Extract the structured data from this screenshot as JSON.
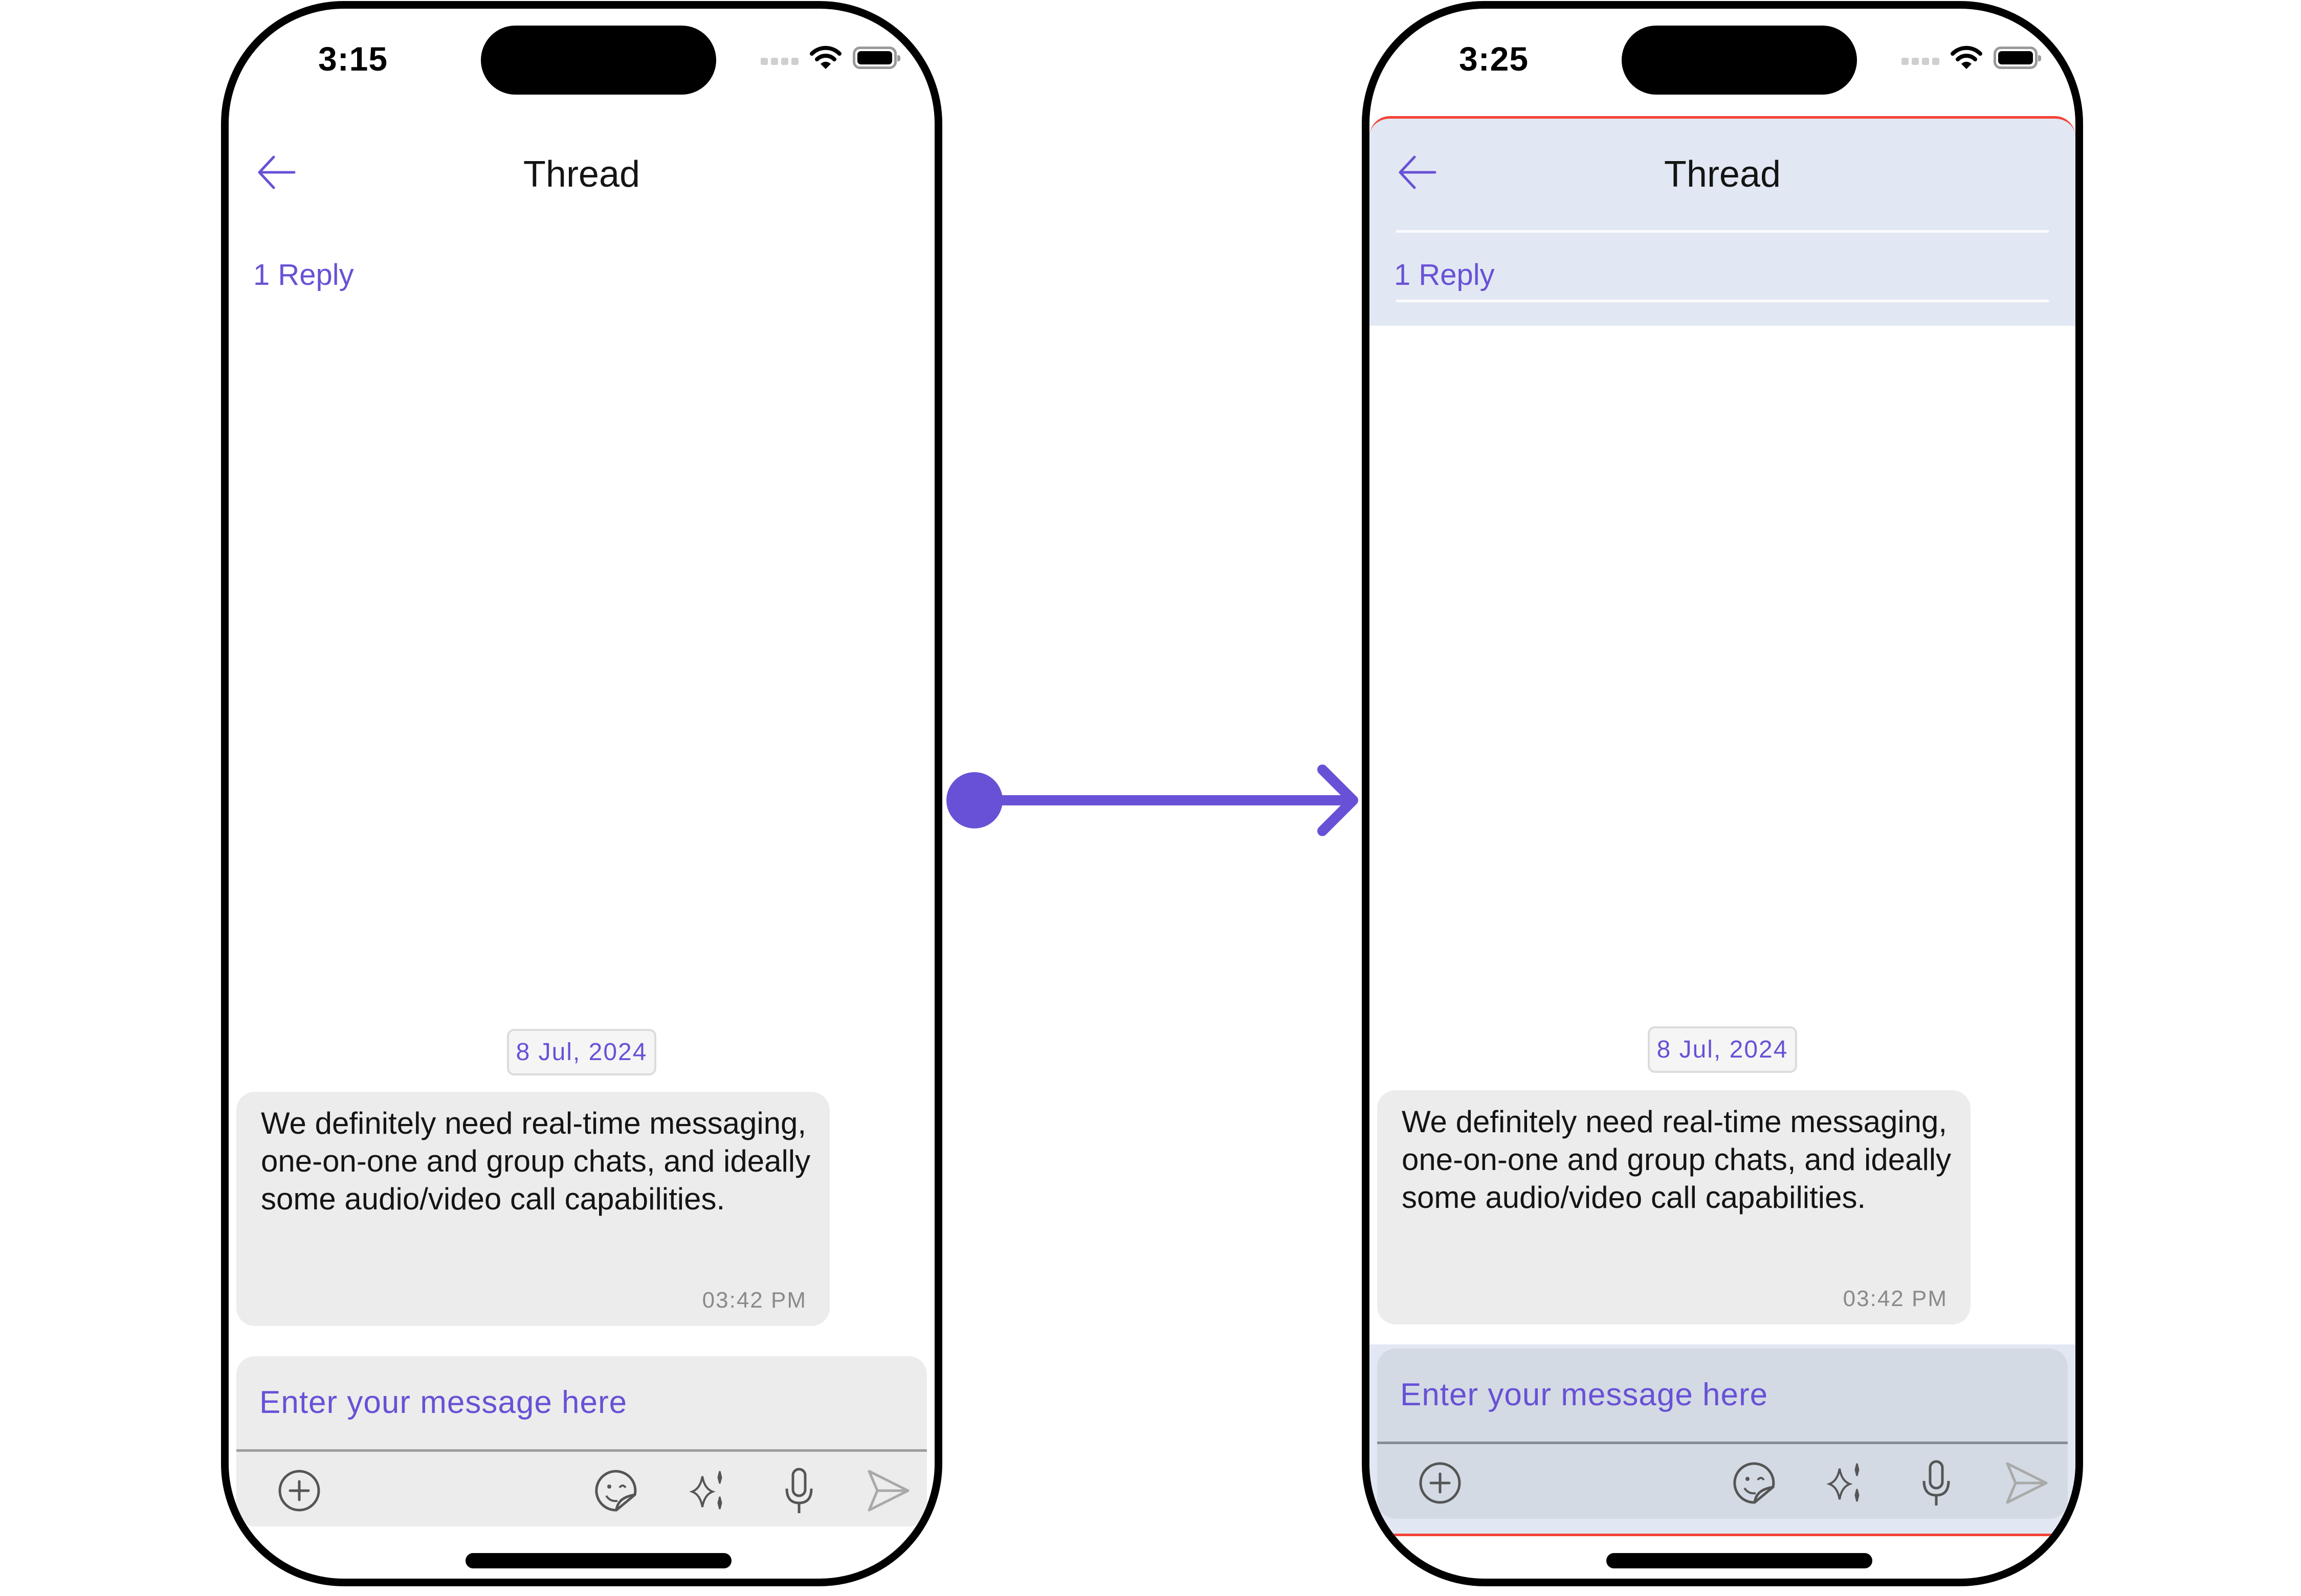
{
  "theme": {
    "accent": "#6851d6",
    "highlight_border": "#f44336",
    "highlight_bg": "#e2e8f3"
  },
  "screens": [
    {
      "status_bar": {
        "time": "3:15",
        "icons": [
          "cellular-signal-icon",
          "wifi-icon",
          "battery-icon"
        ]
      },
      "header": {
        "back_icon": "back-arrow-icon",
        "title": "Thread"
      },
      "reply_count": "1 Reply",
      "date_separator": "8 Jul, 2024",
      "message": {
        "text": "We definitely need real-time messaging, one-on-one and group chats, and ideally some audio/video call capabilities.",
        "time": "03:42 PM"
      },
      "composer": {
        "placeholder": "Enter your message here",
        "actions": [
          "add-attachment-icon",
          "sticker-icon",
          "ai-sparkle-icon",
          "microphone-icon",
          "send-icon"
        ]
      }
    },
    {
      "status_bar": {
        "time": "3:25",
        "icons": [
          "cellular-signal-icon",
          "wifi-icon",
          "battery-icon"
        ]
      },
      "header": {
        "back_icon": "back-arrow-icon",
        "title": "Thread"
      },
      "reply_count": "1 Reply",
      "date_separator": "8 Jul, 2024",
      "message": {
        "text": "We definitely need real-time messaging, one-on-one and group chats, and ideally some audio/video call capabilities.",
        "time": "03:42 PM"
      },
      "composer": {
        "placeholder": "Enter your message here",
        "actions": [
          "add-attachment-icon",
          "sticker-icon",
          "ai-sparkle-icon",
          "microphone-icon",
          "send-icon"
        ]
      }
    }
  ],
  "transition": {
    "icon": "transition-arrow-icon"
  }
}
